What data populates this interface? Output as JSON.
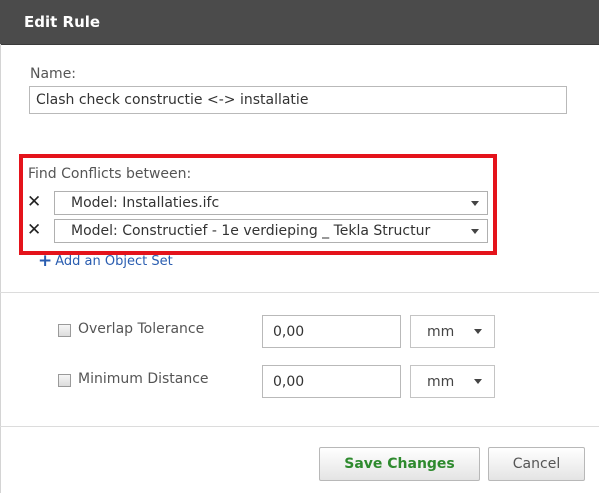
{
  "dialog": {
    "title": "Edit Rule"
  },
  "name": {
    "label": "Name:",
    "value": "Clash check constructie <-> installatie"
  },
  "conflicts": {
    "label": "Find Conflicts between:",
    "remove_glyph": "✕",
    "sets": [
      {
        "value": "Model: Installaties.ifc"
      },
      {
        "value": "Model: Constructief - 1e verdieping _ Tekla Structur"
      }
    ],
    "add_label": "Add an Object Set",
    "add_glyph": "+"
  },
  "options": [
    {
      "label": "Overlap Tolerance",
      "checked": false,
      "value": "0,00",
      "unit": "mm"
    },
    {
      "label": "Minimum Distance",
      "checked": false,
      "value": "0,00",
      "unit": "mm"
    }
  ],
  "buttons": {
    "save": "Save Changes",
    "cancel": "Cancel"
  },
  "colors": {
    "titlebar": "#4b4b4b",
    "highlight": "#e4131b",
    "save_text": "#2e8a2e",
    "link": "#2a5db0"
  },
  "icons": {
    "remove": "close-icon",
    "dropdown": "chevron-down-icon",
    "add": "plus-icon"
  }
}
